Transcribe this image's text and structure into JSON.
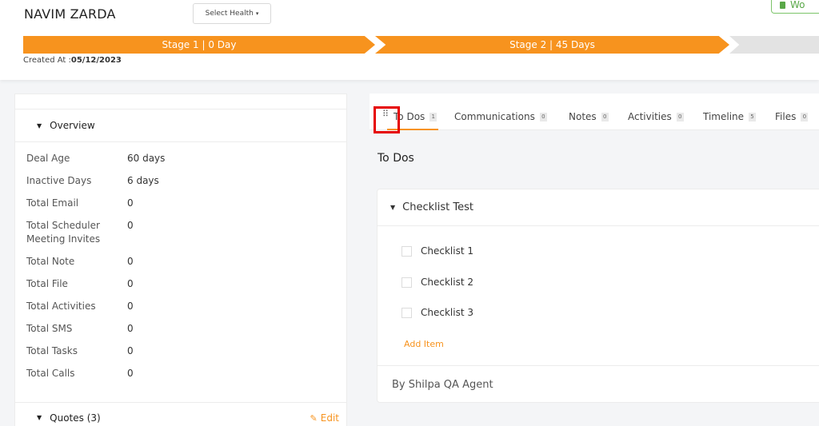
{
  "header": {
    "contact_name": "NAVIM ZARDA",
    "health_select": "Select Health",
    "won_button": "Wo",
    "stages": [
      {
        "label": "Stage 1 | 0 Day"
      },
      {
        "label": "Stage 2 | 45 Days"
      },
      {
        "label": ""
      }
    ],
    "created_label": "Created At :",
    "created_date": "05/12/2023"
  },
  "overview": {
    "title": "Overview",
    "rows": [
      {
        "label": "Deal Age",
        "value": "60 days"
      },
      {
        "label": "Inactive Days",
        "value": "6 days"
      },
      {
        "label": "Total Email",
        "value": "0"
      },
      {
        "label": "Total Scheduler Meeting Invites",
        "value": "0"
      },
      {
        "label": "Total Note",
        "value": "0"
      },
      {
        "label": "Total File",
        "value": "0"
      },
      {
        "label": "Total Activities",
        "value": "0"
      },
      {
        "label": "Total SMS",
        "value": "0"
      },
      {
        "label": "Total Tasks",
        "value": "0"
      },
      {
        "label": "Total Calls",
        "value": "0"
      }
    ]
  },
  "quotes": {
    "title": "Quotes (3)",
    "edit_label": "Edit"
  },
  "tabs": [
    {
      "label": "To Dos",
      "count": "1"
    },
    {
      "label": "Communications",
      "count": "0"
    },
    {
      "label": "Notes",
      "count": "0"
    },
    {
      "label": "Activities",
      "count": "0"
    },
    {
      "label": "Timeline",
      "count": "5"
    },
    {
      "label": "Files",
      "count": "0"
    }
  ],
  "todos": {
    "title": "To Dos",
    "checklist_title": "Checklist Test",
    "items": [
      {
        "label": "Checklist 1"
      },
      {
        "label": "Checklist 2"
      },
      {
        "label": "Checklist 3"
      }
    ],
    "add_item_label": "Add Item",
    "author": "By Shilpa QA Agent"
  },
  "colors": {
    "accent": "#f7931e",
    "highlight": "#e60000",
    "won": "#5aa848"
  }
}
